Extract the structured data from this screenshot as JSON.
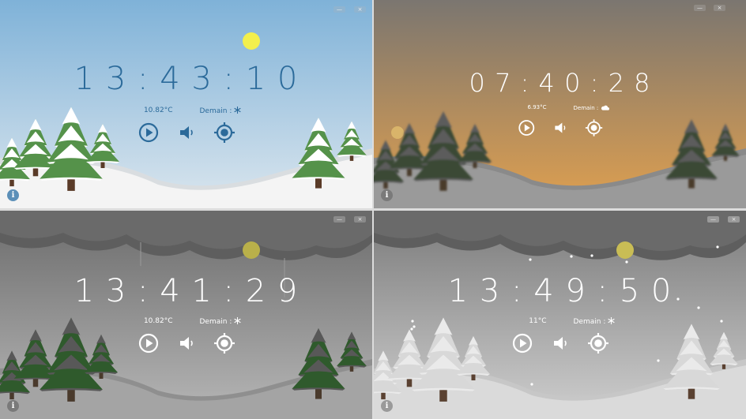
{
  "panels": [
    {
      "time": "13:43:10",
      "temperature": "10.82°C",
      "tomorrow_label": "Demain :",
      "tomorrow_icon": "snowflake-icon",
      "theme": {
        "sky_top": "#7fb2d8",
        "sky_bottom": "#dbe6ee",
        "ground": "#f4f4f4",
        "ground_shadow": "#d9dde0",
        "tree": "#55924a",
        "tree_snow": "#ffffff",
        "trunk": "#5a3b28",
        "text": "#2b6a9a",
        "icon": "#2b6a9a",
        "sun": "#f3ef4c",
        "winctl": "#8fb4d0",
        "info_bg": "#5b8fb8"
      }
    },
    {
      "time": "07:40:28",
      "temperature": "6.93°C",
      "tomorrow_label": "Demain :",
      "tomorrow_icon": "cloud-icon",
      "theme": {
        "sky_top": "#7b7670",
        "sky_bottom": "#e0a04f",
        "ground": "#9a9a9a",
        "ground_shadow": "#8a8a8a",
        "tree": "#3b4a36",
        "tree_snow": "#5b5b5b",
        "trunk": "#4a3a2c",
        "text": "#ffffff",
        "icon": "#ffffff",
        "sun": "#d9b46a",
        "winctl": "#8f8a84",
        "info_bg": "#7a7a7a"
      }
    },
    {
      "time": "13:41:29",
      "temperature": "10.82°C",
      "tomorrow_label": "Demain :",
      "tomorrow_icon": "snowflake-icon",
      "theme": {
        "sky_top": "#6b6b6b",
        "sky_bottom": "#b7b7b7",
        "ground": "#a4a4a4",
        "ground_shadow": "#8f8f8f",
        "tree": "#2f5a2c",
        "tree_snow": "#585858",
        "trunk": "#4a3a2c",
        "text": "#ffffff",
        "icon": "#ffffff",
        "sun": "#b9b04a",
        "winctl": "#8a8a8a",
        "info_bg": "#7a7a7a"
      }
    },
    {
      "time": "13:49:50",
      "temperature": "11°C",
      "tomorrow_label": "Demain :",
      "tomorrow_icon": "snowflake-icon",
      "theme": {
        "sky_top": "#7a7a7a",
        "sky_bottom": "#cfcfcf",
        "ground": "#dadada",
        "ground_shadow": "#c7c7c7",
        "tree": "#d8d8d8",
        "tree_snow": "#eaeaea",
        "trunk": "#5a4131",
        "text": "#ffffff",
        "icon": "#ffffff",
        "sun": "#c9bd55",
        "winctl": "#9a9a9a",
        "info_bg": "#9a9a9a"
      }
    }
  ],
  "controls": {
    "play_icon": "play-icon",
    "volume_icon": "volume-icon",
    "locate_icon": "target-icon",
    "info_icon": "info-icon",
    "minimize_glyph": "—",
    "close_glyph": "×"
  }
}
